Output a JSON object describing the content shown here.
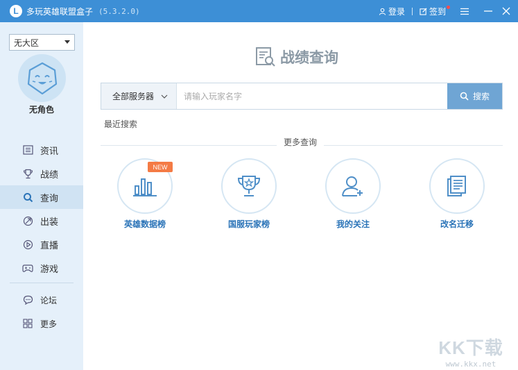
{
  "titlebar": {
    "logo_letter": "L",
    "title": "多玩英雄联盟盒子",
    "version": "(5.3.2.0)",
    "login_label": "登录",
    "checkin_label": "签到"
  },
  "sidebar": {
    "region_selected": "无大区",
    "role_name": "无角色",
    "items": [
      {
        "label": "资讯",
        "icon": "news-icon"
      },
      {
        "label": "战绩",
        "icon": "trophy-icon"
      },
      {
        "label": "查询",
        "icon": "search-icon",
        "active": true
      },
      {
        "label": "出装",
        "icon": "equipment-icon"
      },
      {
        "label": "直播",
        "icon": "play-icon"
      },
      {
        "label": "游戏",
        "icon": "gamepad-icon"
      }
    ],
    "items2": [
      {
        "label": "论坛",
        "icon": "chat-icon"
      },
      {
        "label": "更多",
        "icon": "grid-icon"
      }
    ]
  },
  "main": {
    "title": "战绩查询",
    "server_select": "全部服务器",
    "player_placeholder": "请输入玩家名字",
    "search_button": "搜索",
    "recent_label": "最近搜索",
    "more_label": "更多查询",
    "tiles": [
      {
        "label": "英雄数据榜",
        "icon": "bar-chart-icon",
        "badge": "NEW"
      },
      {
        "label": "国服玩家榜",
        "icon": "cup-icon"
      },
      {
        "label": "我的关注",
        "icon": "user-add-icon"
      },
      {
        "label": "改名迁移",
        "icon": "document-icon"
      }
    ]
  },
  "watermark": {
    "top": "KK下载",
    "bottom": "www.kkx.net"
  },
  "colors": {
    "titlebar": "#3d8fd6",
    "sidebar_bg": "#e5f0fa",
    "sidebar_active": "#d0e3f3",
    "accent_blue": "#2b74b8",
    "search_button": "#6fa5d4",
    "new_badge": "#f47b45"
  }
}
